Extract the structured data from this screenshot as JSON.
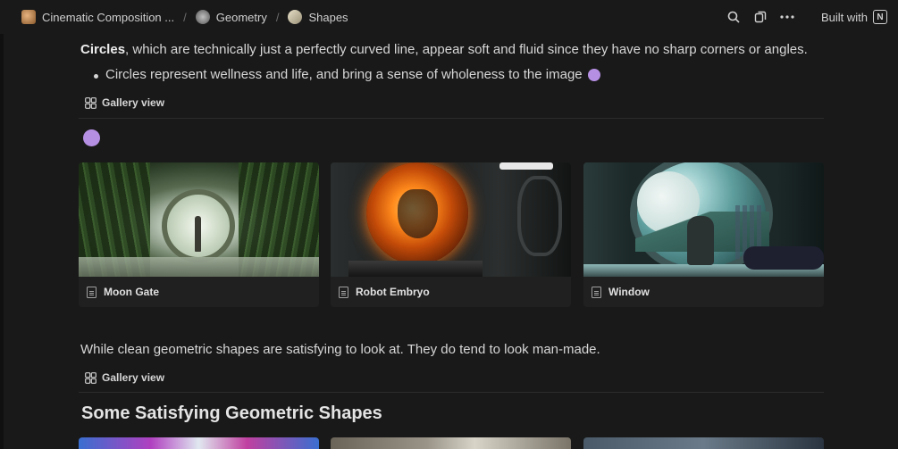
{
  "breadcrumb": {
    "items": [
      {
        "label": "Cinematic Composition ...",
        "icon": "page-thumbnail-icon"
      },
      {
        "label": "Geometry",
        "icon": "sphere-thumbnail-icon"
      },
      {
        "label": "Shapes",
        "icon": "shapes-thumbnail-icon"
      }
    ],
    "separator": "/"
  },
  "topbar": {
    "built_with": "Built with",
    "logo": "N"
  },
  "content": {
    "p1_bold": "Circles",
    "p1_rest": ", which are technically just a perfectly curved line, appear soft and fluid since they have no sharp corners or angles.",
    "bullet": "Circles represent wellness and life, and bring a sense of wholeness to the image",
    "gallery_view_label": "Gallery view",
    "cards": [
      {
        "title": "Moon Gate"
      },
      {
        "title": "Robot Embryo"
      },
      {
        "title": "Window"
      }
    ],
    "p2": "While clean geometric shapes are satisfying to look at. They do tend to look man-made.",
    "gallery_view_label_2": "Gallery view",
    "heading": "Some Satisfying Geometric Shapes"
  },
  "colors": {
    "background": "#191919",
    "accent_dot": "#b58fe2",
    "card": "#202020"
  }
}
